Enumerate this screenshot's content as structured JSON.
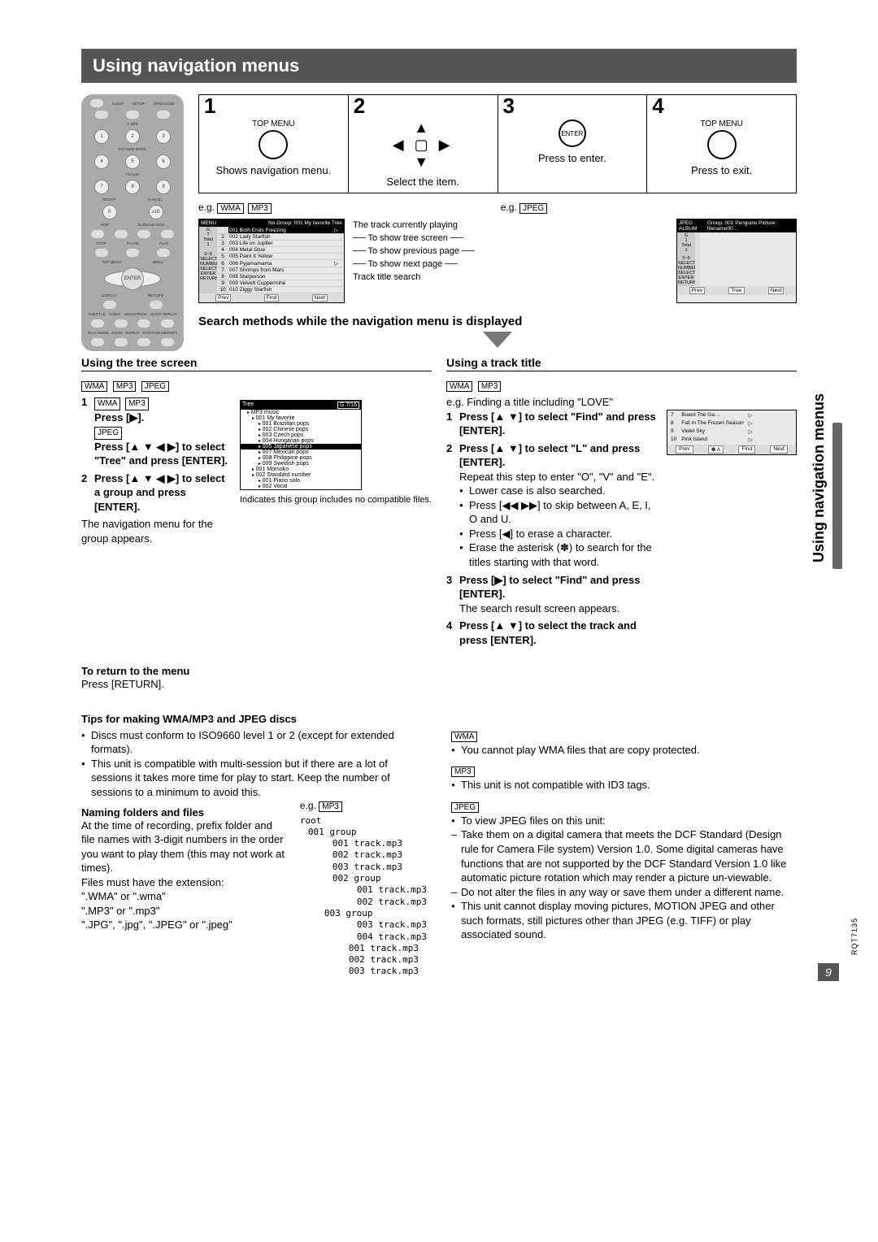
{
  "page_title": "Using navigation menus",
  "steps": [
    {
      "num": "1",
      "label": "TOP MENU",
      "text": "Shows navigation menu."
    },
    {
      "num": "2",
      "label": "",
      "text": "Select the item."
    },
    {
      "num": "3",
      "label": "ENTER",
      "text": "Press to enter."
    },
    {
      "num": "4",
      "label": "TOP MENU",
      "text": "Press to exit."
    }
  ],
  "eg": {
    "left": "e.g.",
    "left_labels": [
      "WMA",
      "MP3"
    ],
    "right": "e.g.",
    "right_labels": [
      "JPEG"
    ]
  },
  "menu_screen1": {
    "header_left": "MENU",
    "header_right": "No    Group: 001 My favorite        Tree",
    "side": {
      "g": "G",
      "t": "T",
      "total": "Total",
      "val": "1"
    },
    "rows": [
      [
        "1",
        "001  Both Ends Freezing",
        "▷"
      ],
      [
        "2",
        "002 Lady Starfish",
        ""
      ],
      [
        "3",
        "003 Life on Jupiter",
        ""
      ],
      [
        "4",
        "004 Metal Glue",
        ""
      ],
      [
        "5",
        "005 Paint It Yellow",
        ""
      ],
      [
        "6",
        "006 Pyjamamama",
        "▷"
      ],
      [
        "7",
        "007 Shrimps from Mars",
        ""
      ],
      [
        "8",
        "008 Starperson",
        ""
      ],
      [
        "9",
        "009 Velvett Cuppermine",
        ""
      ],
      [
        "10",
        "010 Ziggy Starfish",
        ""
      ]
    ],
    "left_labels": [
      "0~9",
      "SELECT NUMBER",
      "SELECT",
      "",
      "ENTER  RETURN"
    ],
    "footer": [
      "Prev",
      "Find",
      "Next"
    ]
  },
  "callouts": [
    "The track currently playing",
    "To show tree screen",
    "To show previous page",
    "To show next page",
    "Track title search"
  ],
  "jpeg_screen": {
    "header": "JPEG ALBUM",
    "header_right": "Group: 001 Penguins   Picture: filename00…",
    "side": {
      "g": "G",
      "total": "Total",
      "gval": "1",
      "tval": "1"
    },
    "left_labels": [
      "0~9",
      "SELECT NUMBER",
      "SELECT",
      "",
      "ENTER  RETURN"
    ],
    "footer": [
      "Prev",
      "Tree",
      "Next"
    ]
  },
  "search_title": "Search methods while the navigation menu is displayed",
  "tree": {
    "heading": "Using the tree screen",
    "labels": [
      "WMA",
      "MP3",
      "JPEG"
    ],
    "step1_lead_labels": [
      "WMA",
      "MP3"
    ],
    "step1_a": "Press [▶].",
    "step1_label2": "JPEG",
    "step1_b": "Press [▲ ▼ ◀ ▶] to select \"Tree\" and press [ENTER].",
    "step2": "Press [▲ ▼ ◀ ▶] to select a group and press [ENTER].",
    "note": "The navigation menu for the group appears.",
    "mini_header": "Tree",
    "mini_g": "G  7/16",
    "mini_rows": [
      "MP3 music",
      "001 My favorite",
      "001 Brazilian pops",
      "002 Chinese pops",
      "003 Czech pops",
      "004 Hungarian pops",
      "005 Japanese pops",
      "007 Mexican pops",
      "008 Philippine pops",
      "009 Swedish pops",
      "001 Momoko",
      "002 Standard number",
      "001 Piano solo",
      "002 Vocal"
    ],
    "mini_caption": "Indicates this group includes no compatible files."
  },
  "track": {
    "heading": "Using a track title",
    "labels": [
      "WMA",
      "MP3"
    ],
    "intro": "e.g. Finding a title including \"LOVE\"",
    "step1": "Press [▲ ▼] to select \"Find\" and press [ENTER].",
    "step2": "Press [▲ ▼] to select \"L\" and press [ENTER].",
    "notes": [
      "Repeat this step to enter \"O\", \"V\" and \"E\".",
      "Lower case is also searched.",
      "Press [◀◀ ▶▶] to skip between A, E, I, O and U.",
      "Press [◀] to erase a character.",
      "Erase the asterisk (✽) to search for the titles starting with that word."
    ],
    "step3": "Press [▶] to select \"Find\" and press [ENTER].",
    "step3_note": "The search result screen appears.",
    "step4": "Press [▲ ▼] to select the track and press [ENTER].",
    "mini_rows": [
      [
        "7",
        "Board The Ga…",
        "▷"
      ],
      [
        "8",
        "Fall In The Frozen Season",
        "▷"
      ],
      [
        "9",
        "Violet Sky",
        "▷"
      ],
      [
        "10",
        "Pink Island",
        "▷"
      ]
    ],
    "mini_footer": [
      "Prev",
      "✽  A",
      "Find",
      "Next"
    ]
  },
  "return": {
    "heading": "To return to the menu",
    "text": "Press [RETURN]."
  },
  "tips": {
    "heading": "Tips for making WMA/MP3 and JPEG discs",
    "left_bullets": [
      "Discs must conform to ISO9660 level 1 or 2 (except for extended formats).",
      "This unit is compatible with multi-session but if there are a lot of sessions it takes more time for play to start. Keep the number of sessions to a minimum to avoid this."
    ],
    "naming_h": "Naming folders and files",
    "naming_text": "At the time of recording, prefix folder and file names with 3-digit numbers in the order you want to play them (this may not work at times).\nFiles must have the extension:\n\".WMA\" or \".wma\"\n\".MP3\" or \".mp3\"\n\".JPG\", \".jpg\", \".JPEG\" or \".jpeg\"",
    "eg_label": "e.g.",
    "eg_fmt": "MP3",
    "folder_tree": [
      "root",
      "001 group",
      "001 track.mp3",
      "002 track.mp3",
      "003 track.mp3",
      "002 group",
      "001 track.mp3",
      "002 track.mp3",
      "003 track.mp3",
      "004 track.mp3",
      "003 group",
      "001 track.mp3",
      "002 track.mp3",
      "003 track.mp3"
    ],
    "right": {
      "wma": {
        "label": "WMA",
        "bul": "You cannot play WMA files that are copy protected."
      },
      "mp3": {
        "label": "MP3",
        "bul": "This unit is not compatible with ID3 tags."
      },
      "jpeg": {
        "label": "JPEG",
        "bul": "To view JPEG files on this unit:",
        "dash1": "Take them on a digital camera that meets the DCF Standard (Design rule for Camera File system) Version 1.0. Some digital cameras have functions that are not supported by the DCF Standard Version 1.0 like automatic picture rotation which may render a picture un-viewable.",
        "dash2": "Do not alter the files in any way or save them under a different name.",
        "bul2": "This unit cannot display moving pictures, MOTION JPEG and other such formats, still pictures other than JPEG (e.g. TIFF) or play associated sound."
      }
    }
  },
  "vertical_tab": "Using navigation menus",
  "page_num": "9",
  "code": "RQT7135",
  "remote_labels": {
    "sleep": "SLEEP",
    "setup": "SETUP",
    "opclose": "OPN/CLOSE",
    "aspd": "A.SPD",
    "pict": "PICTURE MODE",
    "flaud": "FL/AUD",
    "group": "GROUP",
    "cancel": "CANCEL",
    "skip": "SKIP",
    "slow": "SLOW/SEARCH",
    "stop": "STOP",
    "pause": "PAUSE",
    "play": "PLAY",
    "top": "TOP MENU",
    "menu": "MENU",
    "enter": "ENTER",
    "display": "DISPLAY",
    "return": "RETURN",
    "subtitle": "SUBTITLE",
    "audio": "AUDIO",
    "angle": "ANGLE/PAGE",
    "quick": "QUICK REPLAY",
    "playmode": "PLAY MODE",
    "zoom": "ZOOM",
    "repeat": "REPEAT",
    "position": "POSITION MEMORY"
  }
}
